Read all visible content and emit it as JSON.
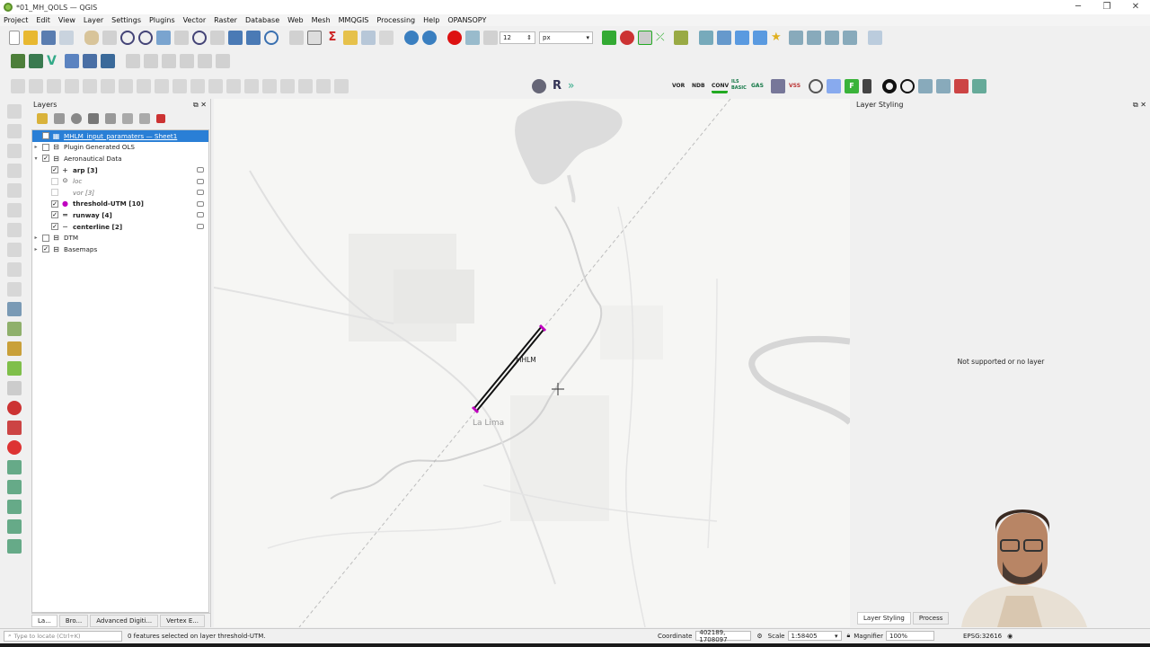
{
  "window": {
    "title": "*01_MH_QOLS — QGIS",
    "controls": [
      "─",
      "❐",
      "✕"
    ]
  },
  "menu": [
    "Project",
    "Edit",
    "View",
    "Layer",
    "Settings",
    "Plugins",
    "Vector",
    "Raster",
    "Database",
    "Web",
    "Mesh",
    "MMQGIS",
    "Processing",
    "Help",
    "OPANSOPY"
  ],
  "toolbar": {
    "label_size_value": "12",
    "label_unit": "px",
    "vor": "VOR",
    "ndb": "NDB",
    "conv": "CONV",
    "basic_ils": "ILS\nBASIC",
    "gas": "GAS",
    "vss": "VSS",
    "f_button": "F"
  },
  "layers_panel": {
    "title": "Layers",
    "items": [
      {
        "label": "MHLM_input_paramaters — Sheet1",
        "checked": false,
        "selected": true,
        "expander": "",
        "icon": "table"
      },
      {
        "label": "Plugin Generated OLS",
        "checked": false,
        "expander": "▸",
        "icon": "group"
      },
      {
        "label": "Aeronautical Data",
        "checked": true,
        "expander": "▾",
        "icon": "group"
      },
      {
        "label": "arp [3]",
        "checked": true,
        "expander": "",
        "icon": "cross",
        "bold": true,
        "indent": 1
      },
      {
        "label": "loc",
        "checked": false,
        "expander": "",
        "icon": "circle",
        "italic": true,
        "indent": 1
      },
      {
        "label": "vor [3]",
        "checked": false,
        "expander": "",
        "icon": "none",
        "italic": true,
        "indent": 1
      },
      {
        "label": "threshold-UTM [10]",
        "checked": true,
        "expander": "",
        "icon": "dot",
        "bold": true,
        "indent": 1
      },
      {
        "label": "runway [4]",
        "checked": true,
        "expander": "",
        "icon": "bars",
        "bold": true,
        "indent": 1
      },
      {
        "label": "centerline [2]",
        "checked": true,
        "expander": "",
        "icon": "line",
        "bold": true,
        "indent": 1
      },
      {
        "label": "DTM",
        "checked": false,
        "expander": "▸",
        "icon": "group"
      },
      {
        "label": "Basemaps",
        "checked": true,
        "expander": "▸",
        "icon": "group"
      }
    ],
    "tabs": [
      "La...",
      "Bro...",
      "Advanced Digiti...",
      "Vertex E..."
    ]
  },
  "map": {
    "airport_label": "MHLM",
    "town_label": "La Lima",
    "runway_color": "#c000c0"
  },
  "styling_panel": {
    "title": "Layer Styling",
    "message": "Not supported or no layer",
    "tabs": [
      "Layer Styling",
      "Process"
    ]
  },
  "status": {
    "locator_placeholder": "Type to locate (Ctrl+K)",
    "message": "0 features selected on layer threshold-UTM.",
    "coordinate_label": "Coordinate",
    "coordinate": "402189, 1708097",
    "scale_label": "Scale",
    "scale": "1:58405",
    "magnifier_label": "Magnifier",
    "magnifier": "100%",
    "crs": "EPSG:32616"
  }
}
